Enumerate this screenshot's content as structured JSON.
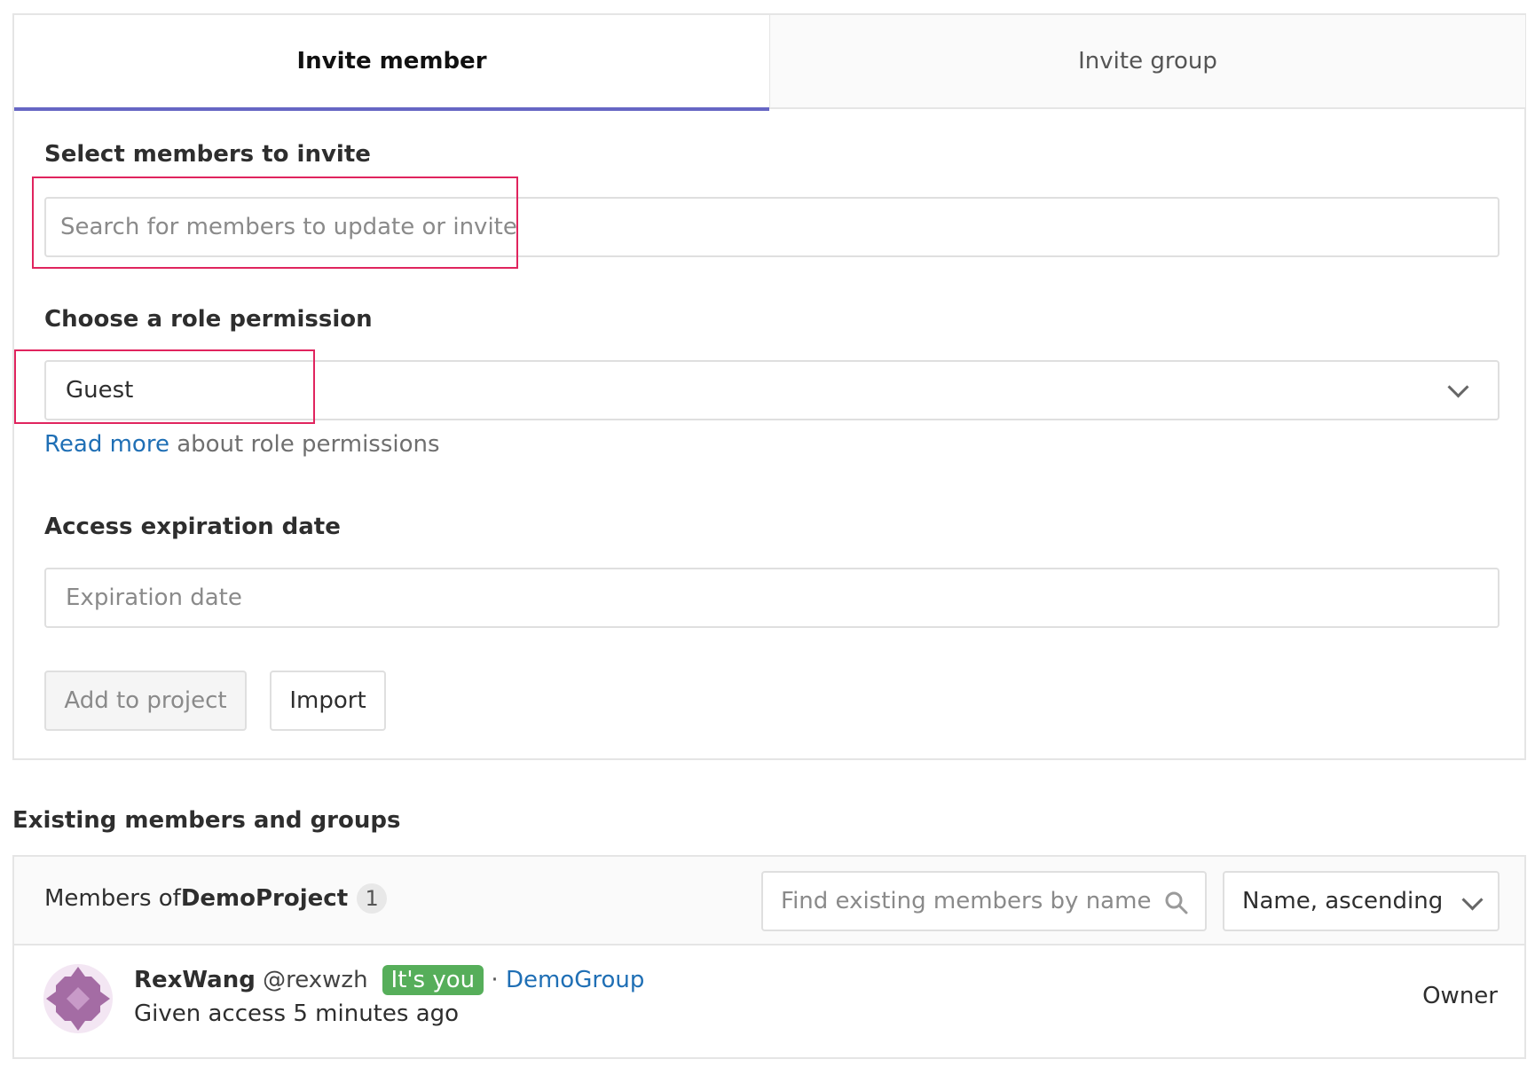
{
  "tabs": {
    "invite_member": "Invite member",
    "invite_group": "Invite group"
  },
  "invite_form": {
    "select_members_label": "Select members to invite",
    "search_placeholder": "Search for members to update or invite",
    "role_label": "Choose a role permission",
    "role_value": "Guest",
    "read_more_link": "Read more",
    "read_more_suffix": " about role permissions",
    "expiration_label": "Access expiration date",
    "expiration_placeholder": "Expiration date",
    "add_button": "Add to project",
    "import_button": "Import"
  },
  "existing": {
    "heading": "Existing members and groups",
    "members_of_prefix": "Members of ",
    "project_name": "DemoProject",
    "member_count": "1",
    "filter_placeholder": "Find existing members by name",
    "sort_value": "Name, ascending",
    "members": [
      {
        "name": "RexWang",
        "username": "@rexwzh",
        "badge": "It's you",
        "separator": "·",
        "group": "DemoGroup",
        "access": "Given access 5 minutes ago",
        "role": "Owner"
      }
    ]
  },
  "colors": {
    "tab_active_underline": "#6666c4",
    "highlight_box": "#e0245e",
    "link": "#1f6fb5",
    "badge_green": "#56ae5a"
  },
  "icons": [
    "chevron-down-icon",
    "search-icon",
    "avatar-identicon"
  ]
}
